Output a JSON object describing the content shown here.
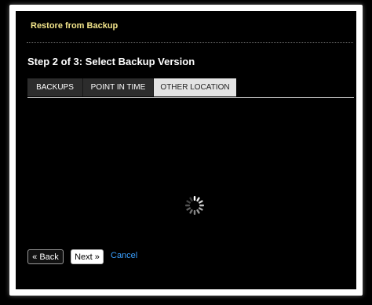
{
  "dialog": {
    "title": "Restore from Backup",
    "step_heading": "Step 2 of 3: Select Backup Version"
  },
  "tabs": [
    {
      "label": "BACKUPS",
      "active": false
    },
    {
      "label": "POINT IN TIME",
      "active": false
    },
    {
      "label": "OTHER LOCATION",
      "active": true
    }
  ],
  "loading": {
    "icon": "loading-spinner-icon"
  },
  "actions": {
    "back_label": "« Back",
    "next_label": "Next »",
    "cancel_label": "Cancel"
  },
  "colors": {
    "title": "#f2e48a",
    "link": "#3aa0ff",
    "active_tab": "#e3e3e3",
    "inactive_tab": "#2c2c2c"
  }
}
